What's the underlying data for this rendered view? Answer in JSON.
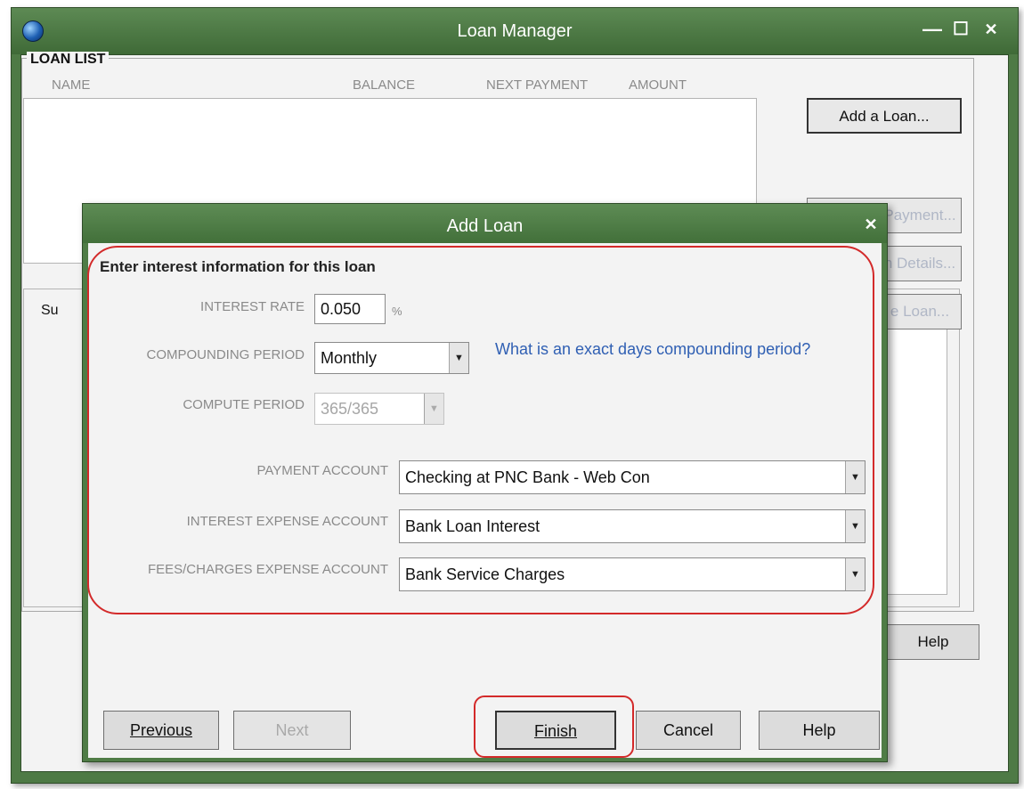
{
  "colors": {
    "title_bar": "#4e7a45",
    "highlight": "#d32a2a",
    "link": "#2f5fb3"
  },
  "window": {
    "title": "Loan Manager",
    "controls": {
      "minimize": "—",
      "maximize": "☐",
      "close": "✕"
    }
  },
  "loan_list": {
    "title": "LOAN LIST",
    "columns": [
      "NAME",
      "BALANCE",
      "NEXT PAYMENT",
      "AMOUNT"
    ],
    "buttons": {
      "add_loan": "Add a Loan...",
      "payment_partial": "Payment...",
      "details_partial": "n Details...",
      "loan_partial": "e Loan..."
    },
    "summary_partial": "Su",
    "help": "Help"
  },
  "dialog": {
    "title": "Add Loan",
    "close": "✕",
    "heading": "Enter interest information for this loan",
    "interest_rate": {
      "label": "INTEREST RATE",
      "value": "0.050",
      "unit": "%"
    },
    "compounding_period": {
      "label": "COMPOUNDING PERIOD",
      "value": "Monthly"
    },
    "help_link": "What is an exact days compounding period?",
    "compute_period": {
      "label": "COMPUTE PERIOD",
      "value": "365/365"
    },
    "payment_account": {
      "label": "PAYMENT ACCOUNT",
      "value": "Checking at PNC Bank - Web Con"
    },
    "interest_expense_account": {
      "label": "INTEREST EXPENSE ACCOUNT",
      "value": "Bank Loan Interest"
    },
    "fees_expense_account": {
      "label": "FEES/CHARGES EXPENSE ACCOUNT",
      "value": "Bank Service Charges"
    },
    "buttons": {
      "previous": "Previous",
      "next": "Next",
      "finish": "Finish",
      "cancel": "Cancel",
      "help": "Help"
    }
  }
}
